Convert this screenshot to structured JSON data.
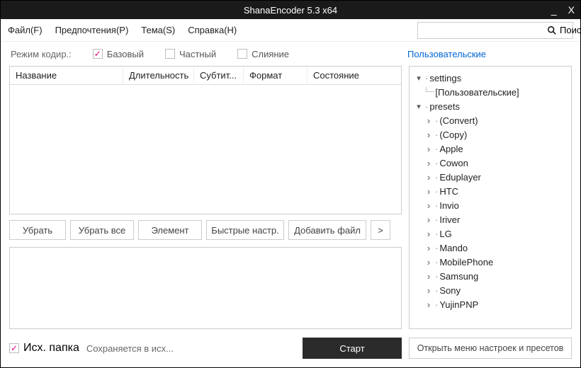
{
  "window": {
    "title": "ShanaEncoder 5.3 x64"
  },
  "titlebar_controls": {
    "minimize": "_",
    "close": "X"
  },
  "menu": {
    "file": "Файл(F)",
    "preferences": "Предпочтения(P)",
    "theme": "Тема(S)",
    "help": "Справка(H)"
  },
  "search": {
    "placeholder": "",
    "button": "Поиск"
  },
  "modebar": {
    "label": "Режим кодир.:",
    "basic": "Базовый",
    "private": "Частный",
    "merge": "Слияние",
    "user_heading": "Пользовательские"
  },
  "table": {
    "headers": {
      "name": "Название",
      "duration": "Длительность",
      "subtitle": "Субтит...",
      "format": "Формат",
      "status": "Состояние"
    }
  },
  "buttons": {
    "remove": "Убрать",
    "remove_all": "Убрать все",
    "element": "Элемент",
    "quick_settings": "Быстрые настр.",
    "add_file": "Добавить файл",
    "more": ">"
  },
  "bottom": {
    "source_folder": "Исх. папка",
    "save_hint": "Сохраняется в исх...",
    "start": "Старт",
    "open_presets": "Открыть меню настроек и пресетов"
  },
  "tree": {
    "settings_label": "settings",
    "settings_children": [
      "[Пользовательские]"
    ],
    "presets_label": "presets",
    "presets_children": [
      "(Convert)",
      "(Copy)",
      "Apple",
      "Cowon",
      "Eduplayer",
      "HTC",
      "Invio",
      "Iriver",
      "LG",
      "Mando",
      "MobilePhone",
      "Samsung",
      "Sony",
      "YujinPNP"
    ]
  }
}
